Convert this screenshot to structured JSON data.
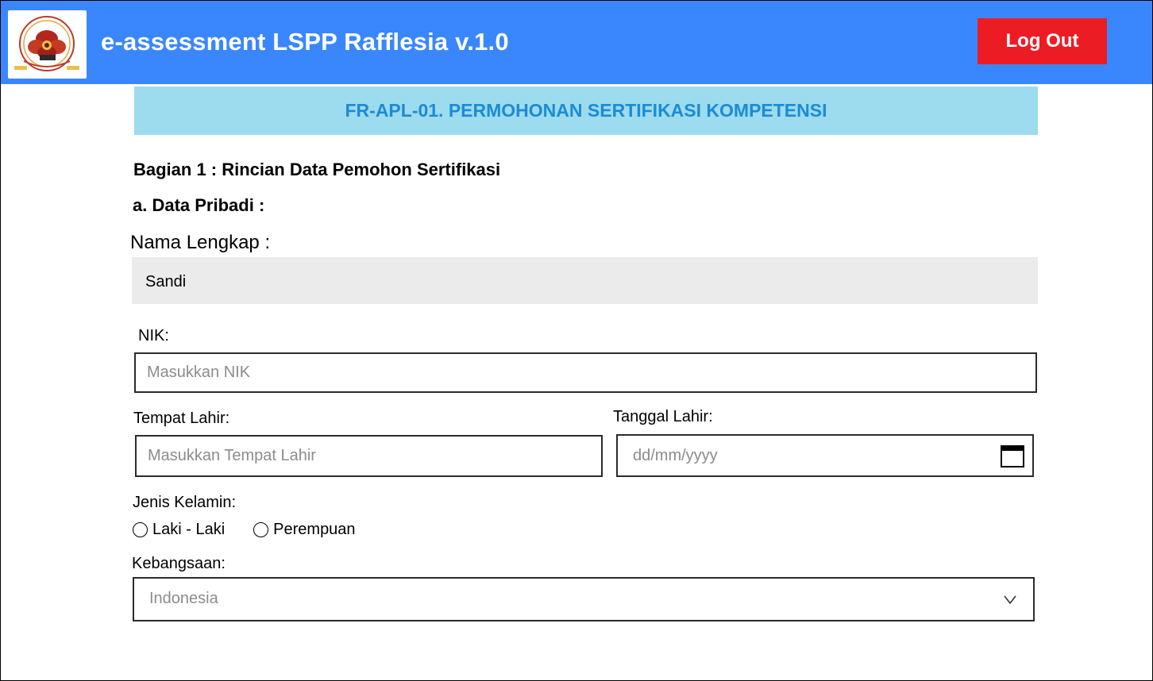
{
  "app": {
    "title": "e-assessment LSPP Rafflesia v.1.0",
    "logout_label": "Log Out",
    "colors": {
      "topbar": "#3a87fd",
      "logout": "#ec1c24",
      "form_header_bg": "#9ddbee",
      "form_header_text": "#1b8bd6"
    }
  },
  "form": {
    "header": "FR-APL-01. PERMOHONAN SERTIFIKASI KOMPETENSI",
    "section_title": "Bagian 1 : Rincian Data Pemohon Sertifikasi",
    "subsection_title": "a. Data Pribadi :",
    "nama_label": "Nama Lengkap :",
    "nama_value": "Sandi",
    "nik_label": "NIK:",
    "nik_placeholder": "Masukkan NIK",
    "tempat_label": "Tempat Lahir:",
    "tempat_placeholder": "Masukkan Tempat Lahir",
    "tanggal_label": "Tanggal Lahir:",
    "tanggal_placeholder": "dd/mm/yyyy",
    "gender_label": "Jenis Kelamin:",
    "gender_options": [
      "Laki - Laki",
      "Perempuan"
    ],
    "kebangsaan_label": "Kebangsaan:",
    "kebangsaan_value": "Indonesia"
  },
  "icons": {
    "logo": "lspp-rafflesia-logo",
    "calendar": "calendar-icon",
    "dropdown": "chevron-down-icon"
  }
}
